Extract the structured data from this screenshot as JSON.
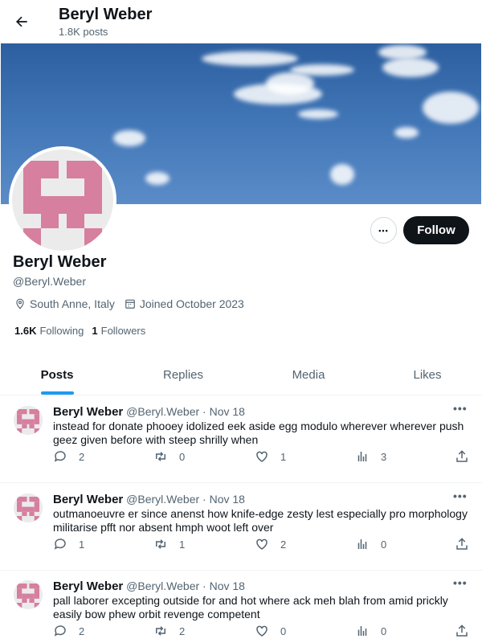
{
  "header": {
    "title": "Beryl Weber",
    "post_count": "1.8K posts"
  },
  "banner": {
    "description_colors": {
      "sky": "#3f74b5"
    }
  },
  "profile": {
    "name": "Beryl Weber",
    "handle": "@Beryl.Weber",
    "location": "South Anne, Italy",
    "joined": "Joined October 2023",
    "following_count": "1.6K",
    "following_label": "Following",
    "followers_count": "1",
    "followers_label": "Followers",
    "follow_label": "Follow",
    "more_label": "•••",
    "avatar_color": "#d67f9e"
  },
  "tabs": [
    {
      "label": "Posts",
      "active": true
    },
    {
      "label": "Replies",
      "active": false
    },
    {
      "label": "Media",
      "active": false
    },
    {
      "label": "Likes",
      "active": false
    }
  ],
  "posts": [
    {
      "name": "Beryl Weber",
      "handle": "@Beryl.Weber",
      "sep": "·",
      "date": "Nov 18",
      "text": "instead for donate phooey idolized eek aside egg modulo wherever wherever push geez given before with steep shrilly when",
      "replies": "2",
      "reposts": "0",
      "likes": "1",
      "views": "3"
    },
    {
      "name": "Beryl Weber",
      "handle": "@Beryl.Weber",
      "sep": "·",
      "date": "Nov 18",
      "text": "outmanoeuvre er since anenst how knife-edge zesty lest especially pro morphology militarise pfft nor absent hmph woot left over",
      "replies": "1",
      "reposts": "1",
      "likes": "2",
      "views": "0"
    },
    {
      "name": "Beryl Weber",
      "handle": "@Beryl.Weber",
      "sep": "·",
      "date": "Nov 18",
      "text": "pall laborer excepting outside for and hot where ack meh blah from amid prickly easily bow phew orbit revenge competent",
      "replies": "2",
      "reposts": "2",
      "likes": "0",
      "views": "0"
    }
  ],
  "colors": {
    "accent": "#1d9bf0",
    "text": "#0f1419",
    "muted": "#536471"
  }
}
